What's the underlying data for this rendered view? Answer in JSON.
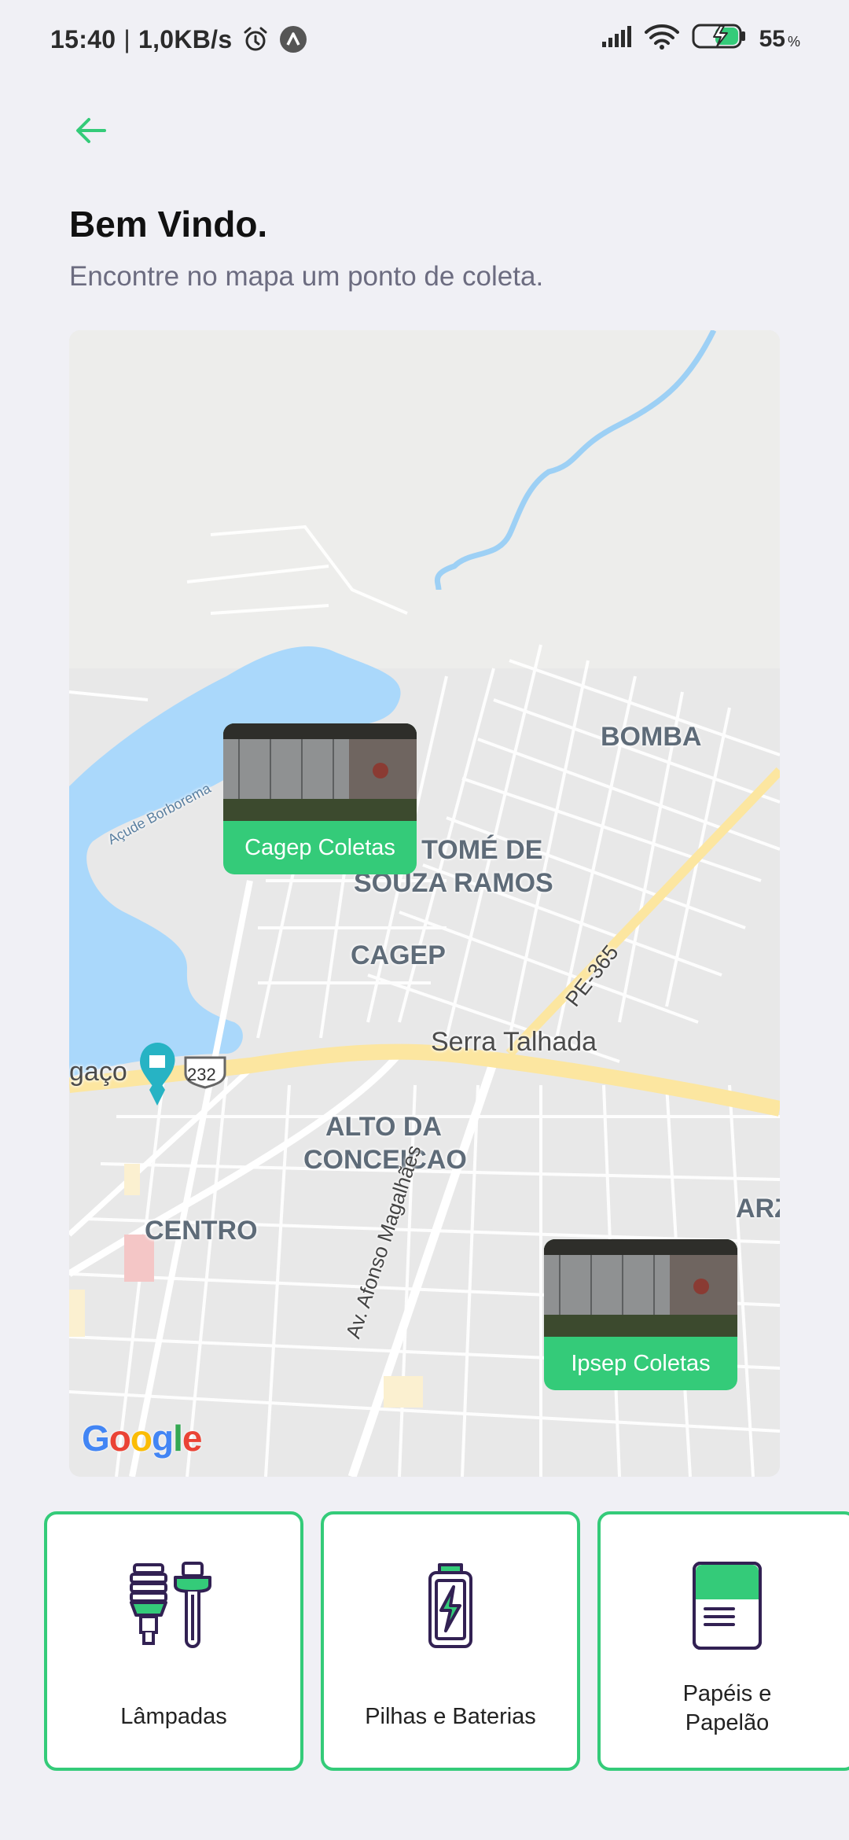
{
  "status_bar": {
    "time": "15:40",
    "separator": "|",
    "net_speed": "1,0KB/s",
    "battery_percent": "55",
    "battery_unit": "%"
  },
  "header": {
    "title": "Bem Vindo.",
    "subtitle": "Encontre no mapa um ponto de coleta."
  },
  "map": {
    "labels": {
      "bomba": "BOMBA",
      "tome_line1": "É TOMÉ DE",
      "tome_line2": "SOUZA RAMOS",
      "cagep": "CAGEP",
      "serra": "Serra Talhada",
      "alto_line1": "ALTO DA",
      "alto_line2": "CONCEICAO",
      "centro": "CENTRO",
      "cut_left": "gaço",
      "cut_right": "ARZ",
      "pe365": "PE-365",
      "br232": "232",
      "avenida": "Av. Afonso Magalhães",
      "acude": "Açude Borborema"
    },
    "markers": [
      {
        "label": "Cagep Coletas"
      },
      {
        "label": "Ipsep Coletas"
      }
    ],
    "attribution": {
      "G": "G",
      "o1": "o",
      "o2": "o",
      "g": "g",
      "l": "l",
      "e": "e"
    }
  },
  "items": [
    {
      "label": "Lâmpadas",
      "icon": "lamps-icon"
    },
    {
      "label": "Pilhas e Baterias",
      "icon": "battery-icon"
    },
    {
      "label": "Papéis e Papelão",
      "icon": "paper-icon"
    }
  ],
  "colors": {
    "accent": "#34CB79",
    "title": "#111111",
    "subtitle": "#6C6C80",
    "background": "#F0F0F5"
  }
}
